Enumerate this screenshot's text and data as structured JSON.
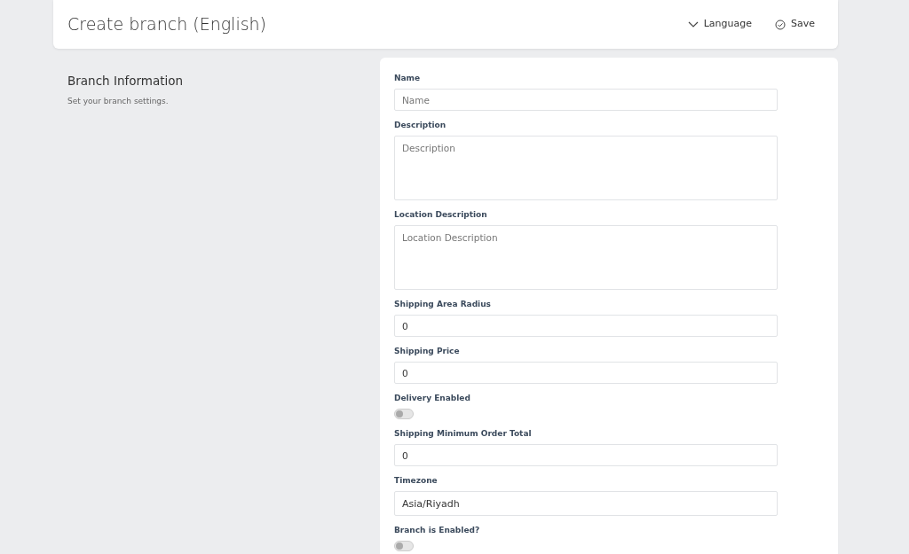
{
  "header": {
    "title": "Create branch (English)",
    "actions": [
      {
        "kind": "dropdown",
        "label": "Language"
      },
      {
        "kind": "save",
        "label": "Save"
      }
    ]
  },
  "section": {
    "title": "Branch Information",
    "description": "Set your branch settings."
  },
  "fields": [
    {
      "kind": "input",
      "label": "Name",
      "placeholder": "Name"
    },
    {
      "kind": "textarea",
      "label": "Description",
      "placeholder": "Description"
    },
    {
      "kind": "textarea",
      "label": "Location Description",
      "placeholder": "Location Description"
    },
    {
      "kind": "input",
      "label": "Shipping Area Radius",
      "value": "0"
    },
    {
      "kind": "input",
      "label": "Shipping Price",
      "value": "0"
    },
    {
      "kind": "toggle",
      "label": "Delivery Enabled",
      "on": false
    },
    {
      "kind": "input",
      "label": "Shipping Minimum Order Total",
      "value": "0"
    },
    {
      "kind": "select",
      "label": "Timezone",
      "value": "Asia/Riyadh"
    },
    {
      "kind": "toggle",
      "label": "Branch is Enabled?",
      "on": false
    }
  ]
}
